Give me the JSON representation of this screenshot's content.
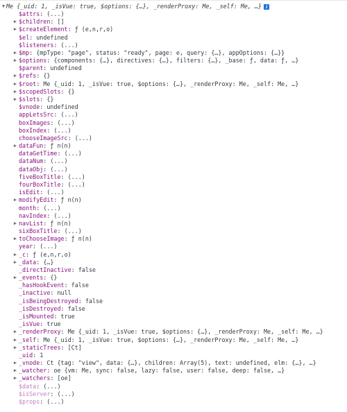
{
  "header": {
    "text": "Me {_uid: 1, _isVue: true, $options: {…}, _renderProxy: Me, _self: Me, …}",
    "info_glyph": "i"
  },
  "rows": [
    {
      "key": "$attrs",
      "value": "(...)",
      "expand": false,
      "dim": false
    },
    {
      "key": "$children",
      "value": "[]",
      "expand": true,
      "dim": false
    },
    {
      "key": "$createElement",
      "value": "ƒ (e,n,r,o)",
      "expand": true,
      "dim": false
    },
    {
      "key": "$el",
      "value": "undefined",
      "expand": false,
      "dim": false
    },
    {
      "key": "$listeners",
      "value": "(...)",
      "expand": false,
      "dim": false
    },
    {
      "key": "$mp",
      "value": "{mpType: \"page\", status: \"ready\", page: e, query: {…}, appOptions: {…}}",
      "expand": true,
      "dim": false
    },
    {
      "key": "$options",
      "value": "{components: {…}, directives: {…}, filters: {…}, _base: ƒ, data: ƒ, …}",
      "expand": true,
      "dim": false
    },
    {
      "key": "$parent",
      "value": "undefined",
      "expand": false,
      "dim": false
    },
    {
      "key": "$refs",
      "value": "{}",
      "expand": true,
      "dim": false
    },
    {
      "key": "$root",
      "value": "Me {_uid: 1, _isVue: true, $options: {…}, _renderProxy: Me, _self: Me, …}",
      "expand": true,
      "dim": false
    },
    {
      "key": "$scopedSlots",
      "value": "{}",
      "expand": true,
      "dim": false
    },
    {
      "key": "$slots",
      "value": "{}",
      "expand": true,
      "dim": false
    },
    {
      "key": "$vnode",
      "value": "undefined",
      "expand": false,
      "dim": false
    },
    {
      "key": "appLetsSrc",
      "value": "(...)",
      "expand": false,
      "dim": false
    },
    {
      "key": "boxImages",
      "value": "(...)",
      "expand": false,
      "dim": false
    },
    {
      "key": "boxIndex",
      "value": "(...)",
      "expand": false,
      "dim": false
    },
    {
      "key": "chooseImageSrc",
      "value": "(...)",
      "expand": false,
      "dim": false
    },
    {
      "key": "dataFun",
      "value": "ƒ n(n)",
      "expand": true,
      "dim": false
    },
    {
      "key": "dataGetTime",
      "value": "(...)",
      "expand": false,
      "dim": false
    },
    {
      "key": "dataNum",
      "value": "(...)",
      "expand": false,
      "dim": false
    },
    {
      "key": "dataObj",
      "value": "(...)",
      "expand": false,
      "dim": false
    },
    {
      "key": "fiveBoxTitle",
      "value": "(...)",
      "expand": false,
      "dim": false
    },
    {
      "key": "fourBoxTitle",
      "value": "(...)",
      "expand": false,
      "dim": false
    },
    {
      "key": "isEdit",
      "value": "(...)",
      "expand": false,
      "dim": false
    },
    {
      "key": "modifyEdit",
      "value": "ƒ n(n)",
      "expand": true,
      "dim": false
    },
    {
      "key": "month",
      "value": "(...)",
      "expand": false,
      "dim": false
    },
    {
      "key": "navIndex",
      "value": "(...)",
      "expand": false,
      "dim": false
    },
    {
      "key": "navList",
      "value": "ƒ n(n)",
      "expand": true,
      "dim": false
    },
    {
      "key": "sixBoxTitle",
      "value": "(...)",
      "expand": false,
      "dim": false
    },
    {
      "key": "toChooseImage",
      "value": "ƒ n(n)",
      "expand": true,
      "dim": false
    },
    {
      "key": "year",
      "value": "(...)",
      "expand": false,
      "dim": false
    },
    {
      "key": "_c",
      "value": "ƒ (e,n,r,o)",
      "expand": true,
      "dim": false
    },
    {
      "key": "_data",
      "value": "{…}",
      "expand": true,
      "dim": false
    },
    {
      "key": "_directInactive",
      "value": "false",
      "expand": false,
      "dim": false
    },
    {
      "key": "_events",
      "value": "{}",
      "expand": true,
      "dim": false
    },
    {
      "key": "_hasHookEvent",
      "value": "false",
      "expand": false,
      "dim": false
    },
    {
      "key": "_inactive",
      "value": "null",
      "expand": false,
      "dim": false
    },
    {
      "key": "_isBeingDestroyed",
      "value": "false",
      "expand": false,
      "dim": false
    },
    {
      "key": "_isDestroyed",
      "value": "false",
      "expand": false,
      "dim": false
    },
    {
      "key": "_isMounted",
      "value": "true",
      "expand": false,
      "dim": false
    },
    {
      "key": "_isVue",
      "value": "true",
      "expand": false,
      "dim": false
    },
    {
      "key": "_renderProxy",
      "value": "Me {_uid: 1, _isVue: true, $options: {…}, _renderProxy: Me, _self: Me, …}",
      "expand": true,
      "dim": false
    },
    {
      "key": "_self",
      "value": "Me {_uid: 1, _isVue: true, $options: {…}, _renderProxy: Me, _self: Me, …}",
      "expand": true,
      "dim": false
    },
    {
      "key": "_staticTrees",
      "value": "[Ct]",
      "expand": true,
      "dim": false
    },
    {
      "key": "_uid",
      "value": "1",
      "expand": false,
      "dim": false
    },
    {
      "key": "_vnode",
      "value": "Ct {tag: \"view\", data: {…}, children: Array(5), text: undefined, elm: {…}, …}",
      "expand": true,
      "dim": false
    },
    {
      "key": "_watcher",
      "value": "oe {vm: Me, sync: false, lazy: false, user: false, deep: false, …}",
      "expand": true,
      "dim": false
    },
    {
      "key": "_watchers",
      "value": "[oe]",
      "expand": true,
      "dim": false
    },
    {
      "key": "$data",
      "value": "(...)",
      "expand": false,
      "dim": true
    },
    {
      "key": "$isServer",
      "value": "(...)",
      "expand": false,
      "dim": true
    },
    {
      "key": "$props",
      "value": "(...)",
      "expand": false,
      "dim": true
    }
  ],
  "colors": {
    "key": "#881280",
    "key_dim": "#c080c0",
    "text": "#303942",
    "info_badge": "#1a73e8"
  }
}
